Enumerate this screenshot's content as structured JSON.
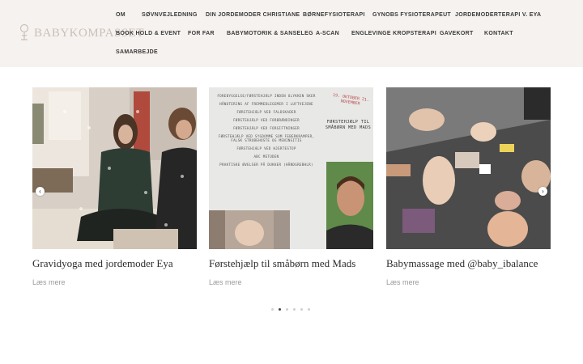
{
  "logo": {
    "text": "BABYKOMPASSET",
    "icon": "stork-icon"
  },
  "nav": {
    "row1": [
      "OM",
      "SØVNVEJLEDNING",
      "DIN JORDEMODER CHRISTIANE",
      "BØRNEFYSIOTERAPI",
      "GYNOBS FYSIOTERAPEUT",
      "JORDEMODERTERAPI V. EYA"
    ],
    "row2": [
      "BOOK HOLD & EVENT",
      "FOR FAR",
      "BABYMOTORIK & SANSELEG",
      "A-SCAN",
      "ENGLEVINGE KROPSTERAPI",
      "GAVEKORT",
      "KONTAKT"
    ],
    "row3": [
      "SAMARBEJDE"
    ]
  },
  "cards": [
    {
      "title": "Gravidyoga med jordemoder Eya",
      "link": "Læs mere"
    },
    {
      "title": "Førstehjælp til småbørn med Mads",
      "link": "Læs mere"
    },
    {
      "title": "Babymassage med @baby_ibalance",
      "link": "Læs mere"
    }
  ],
  "poster": {
    "items": [
      "FOREBYGGELSE/FØRSTEHJÆLP INDEN OLYKKEN SKER",
      "HÅNDTERING AF FREMMEDLEGEMER I LUFTVEJENE",
      "FØRSTEHJÆLP VED FALDSKADER",
      "FØRSTEHJÆLP VED FORBRÆNDINGER",
      "FØRSTEHJÆLP VED FORGIFTNINGER",
      "FØRSTEHJÆLP VED SYGDOMME SOM FEBERKRAMPER, FALSK STRUBEHOSTE OG MENINGITIS",
      "FØRSTEHJÆLP VED HJERTESTOP",
      "ABC METODEN",
      "PRAKTISKE ØVELSER PÅ DUKKER (HÅNDGREBHLR)"
    ],
    "dates": "19. OKTOBER 21. NOVEMBER",
    "headline": "FØRSTEHJÆLP TIL SMÅBØRN MED MADS"
  },
  "carousel": {
    "prev": "‹",
    "next": "›",
    "dots": 6,
    "active_dot": 1
  },
  "colors": {
    "header_bg": "#f6f2ef",
    "nav_text": "#3a3a3a",
    "logo": "#c9c0b8"
  }
}
